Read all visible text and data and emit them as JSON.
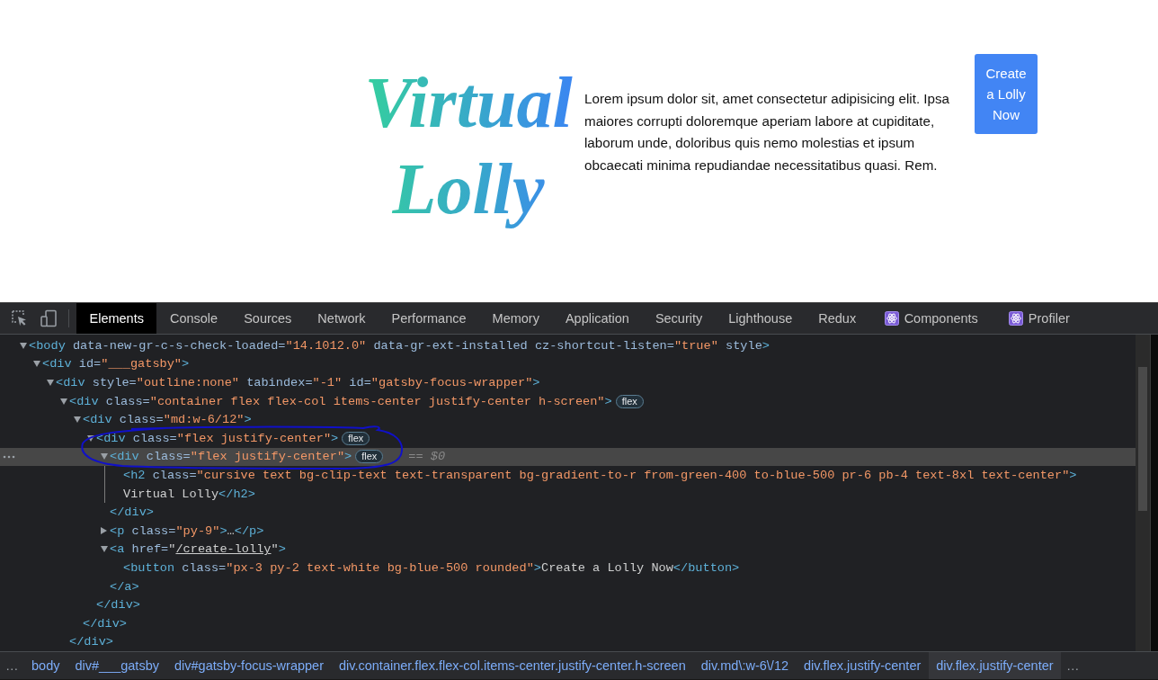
{
  "page": {
    "title": "Virtual Lolly",
    "paragraph": "Lorem ipsum dolor sit, amet consectetur adipisicing elit. Ipsa maiores corrupti doloremque aperiam labore at cupiditate, laborum unde, doloribus quis nemo molestias et ipsum obcaecati minima repudiandae necessitatibus quasi. Rem.",
    "button": "Create a Lolly Now"
  },
  "devtools": {
    "tabs": [
      {
        "label": "Elements",
        "kind": "plain",
        "selected": true
      },
      {
        "label": "Console",
        "kind": "plain",
        "selected": false
      },
      {
        "label": "Sources",
        "kind": "plain",
        "selected": false
      },
      {
        "label": "Network",
        "kind": "plain",
        "selected": false
      },
      {
        "label": "Performance",
        "kind": "plain",
        "selected": false
      },
      {
        "label": "Memory",
        "kind": "plain",
        "selected": false
      },
      {
        "label": "Application",
        "kind": "plain",
        "selected": false
      },
      {
        "label": "Security",
        "kind": "plain",
        "selected": false
      },
      {
        "label": "Lighthouse",
        "kind": "plain",
        "selected": false
      },
      {
        "label": "Redux",
        "kind": "plain",
        "selected": false
      },
      {
        "label": "Components",
        "kind": "react",
        "selected": false
      },
      {
        "label": "Profiler",
        "kind": "react",
        "selected": false
      }
    ],
    "dom": [
      {
        "expanded": true,
        "selected": false,
        "tokens": [
          {
            "kind": "tag",
            "text": "<body"
          },
          {
            "kind": "attr",
            "text": " data-new-gr-c-s-check-loaded="
          },
          {
            "kind": "value",
            "text": "\"14.1012.0\""
          },
          {
            "kind": "attr",
            "text": " data-gr-ext-installed cz-shortcut-listen="
          },
          {
            "kind": "value",
            "text": "\"true\""
          },
          {
            "kind": "attr",
            "text": " style"
          },
          {
            "kind": "tag",
            "text": ">"
          }
        ],
        "children": [
          {
            "expanded": true,
            "selected": false,
            "tokens": [
              {
                "kind": "tag",
                "text": "<div"
              },
              {
                "kind": "attr",
                "text": " id="
              },
              {
                "kind": "value",
                "text": "\"___gatsby\""
              },
              {
                "kind": "tag",
                "text": ">"
              }
            ],
            "children": [
              {
                "expanded": true,
                "selected": false,
                "tokens": [
                  {
                    "kind": "tag",
                    "text": "<div"
                  },
                  {
                    "kind": "attr",
                    "text": " style="
                  },
                  {
                    "kind": "value",
                    "text": "\"outline:none\""
                  },
                  {
                    "kind": "attr",
                    "text": " tabindex="
                  },
                  {
                    "kind": "value",
                    "text": "\"-1\""
                  },
                  {
                    "kind": "attr",
                    "text": " id="
                  },
                  {
                    "kind": "value",
                    "text": "\"gatsby-focus-wrapper\""
                  },
                  {
                    "kind": "tag",
                    "text": ">"
                  }
                ],
                "children": [
                  {
                    "expanded": true,
                    "selected": false,
                    "badge": "flex",
                    "tokens": [
                      {
                        "kind": "tag",
                        "text": "<div"
                      },
                      {
                        "kind": "attr",
                        "text": " class="
                      },
                      {
                        "kind": "value",
                        "text": "\"container flex flex-col items-center justify-center h-screen\""
                      },
                      {
                        "kind": "tag",
                        "text": ">"
                      }
                    ],
                    "children": [
                      {
                        "expanded": true,
                        "selected": false,
                        "tokens": [
                          {
                            "kind": "tag",
                            "text": "<div"
                          },
                          {
                            "kind": "attr",
                            "text": " class="
                          },
                          {
                            "kind": "value",
                            "text": "\"md:w-6/12\""
                          },
                          {
                            "kind": "tag",
                            "text": ">"
                          }
                        ],
                        "children": [
                          {
                            "expanded": true,
                            "selected": false,
                            "badge": "flex",
                            "tokens": [
                              {
                                "kind": "tag",
                                "text": "<div"
                              },
                              {
                                "kind": "attr",
                                "text": " class="
                              },
                              {
                                "kind": "value",
                                "text": "\"flex justify-center\""
                              },
                              {
                                "kind": "tag",
                                "text": ">"
                              }
                            ],
                            "children": [
                              {
                                "expanded": true,
                                "selected": true,
                                "badge": "flex",
                                "hint": "== $0",
                                "tokens": [
                                  {
                                    "kind": "tag",
                                    "text": "<div"
                                  },
                                  {
                                    "kind": "attr",
                                    "text": " class="
                                  },
                                  {
                                    "kind": "value",
                                    "text": "\"flex justify-center\""
                                  },
                                  {
                                    "kind": "tag",
                                    "text": ">"
                                  }
                                ],
                                "children": [
                                  {
                                    "selected": false,
                                    "tokens": [
                                      {
                                        "kind": "tag",
                                        "text": "<h2"
                                      },
                                      {
                                        "kind": "attr",
                                        "text": " class="
                                      },
                                      {
                                        "kind": "value",
                                        "text": "\"cursive text bg-clip-text text-transparent bg-gradient-to-r from-green-400 to-blue-500 pr-6 pb-4 text-8xl text-center\""
                                      },
                                      {
                                        "kind": "tag",
                                        "text": ">"
                                      }
                                    ],
                                    "continuation": [
                                      {
                                        "kind": "text",
                                        "text": "Virtual Lolly"
                                      },
                                      {
                                        "kind": "tag",
                                        "text": "</h2>"
                                      }
                                    ]
                                  }
                                ],
                                "close": [
                                  {
                                    "kind": "tag",
                                    "text": "</div>"
                                  }
                                ]
                              },
                              {
                                "expanded": false,
                                "selected": false,
                                "tokens": [
                                  {
                                    "kind": "tag",
                                    "text": "<p"
                                  },
                                  {
                                    "kind": "attr",
                                    "text": " class="
                                  },
                                  {
                                    "kind": "value",
                                    "text": "\"py-9\""
                                  },
                                  {
                                    "kind": "tag",
                                    "text": ">"
                                  },
                                  {
                                    "kind": "text",
                                    "text": "…"
                                  },
                                  {
                                    "kind": "tag",
                                    "text": "</p>"
                                  }
                                ]
                              },
                              {
                                "expanded": true,
                                "selected": false,
                                "tokens": [
                                  {
                                    "kind": "tag",
                                    "text": "<a"
                                  },
                                  {
                                    "kind": "attr",
                                    "text": " href="
                                  },
                                  {
                                    "kind": "text",
                                    "text": "\""
                                  },
                                  {
                                    "kind": "link",
                                    "text": "/create-lolly"
                                  },
                                  {
                                    "kind": "text",
                                    "text": "\""
                                  },
                                  {
                                    "kind": "tag",
                                    "text": ">"
                                  }
                                ],
                                "children": [
                                  {
                                    "selected": false,
                                    "tokens": [
                                      {
                                        "kind": "tag",
                                        "text": "<button"
                                      },
                                      {
                                        "kind": "attr",
                                        "text": " class="
                                      },
                                      {
                                        "kind": "value",
                                        "text": "\"px-3 py-2 text-white bg-blue-500 rounded\""
                                      },
                                      {
                                        "kind": "tag",
                                        "text": ">"
                                      },
                                      {
                                        "kind": "text",
                                        "text": "Create a Lolly Now"
                                      },
                                      {
                                        "kind": "tag",
                                        "text": "</button>"
                                      }
                                    ]
                                  }
                                ],
                                "close": [
                                  {
                                    "kind": "tag",
                                    "text": "</a>"
                                  }
                                ]
                              }
                            ],
                            "close": [
                              {
                                "kind": "tag",
                                "text": "</div>"
                              }
                            ]
                          }
                        ],
                        "close": [
                          {
                            "kind": "tag",
                            "text": "</div>"
                          }
                        ]
                      }
                    ],
                    "close": [
                      {
                        "kind": "tag",
                        "text": "</div>"
                      }
                    ]
                  }
                ]
              }
            ]
          }
        ]
      }
    ],
    "breadcrumbs": {
      "more_left": "…",
      "more_right": "…",
      "items": [
        {
          "label": "body",
          "selected": false
        },
        {
          "label": "div#___gatsby",
          "selected": false
        },
        {
          "label": "div#gatsby-focus-wrapper",
          "selected": false
        },
        {
          "label": "div.container.flex.flex-col.items-center.justify-center.h-screen",
          "selected": false
        },
        {
          "label": "div.md\\:w-6\\/12",
          "selected": false
        },
        {
          "label": "div.flex.justify-center",
          "selected": false
        },
        {
          "label": "div.flex.justify-center",
          "selected": true
        }
      ]
    }
  }
}
